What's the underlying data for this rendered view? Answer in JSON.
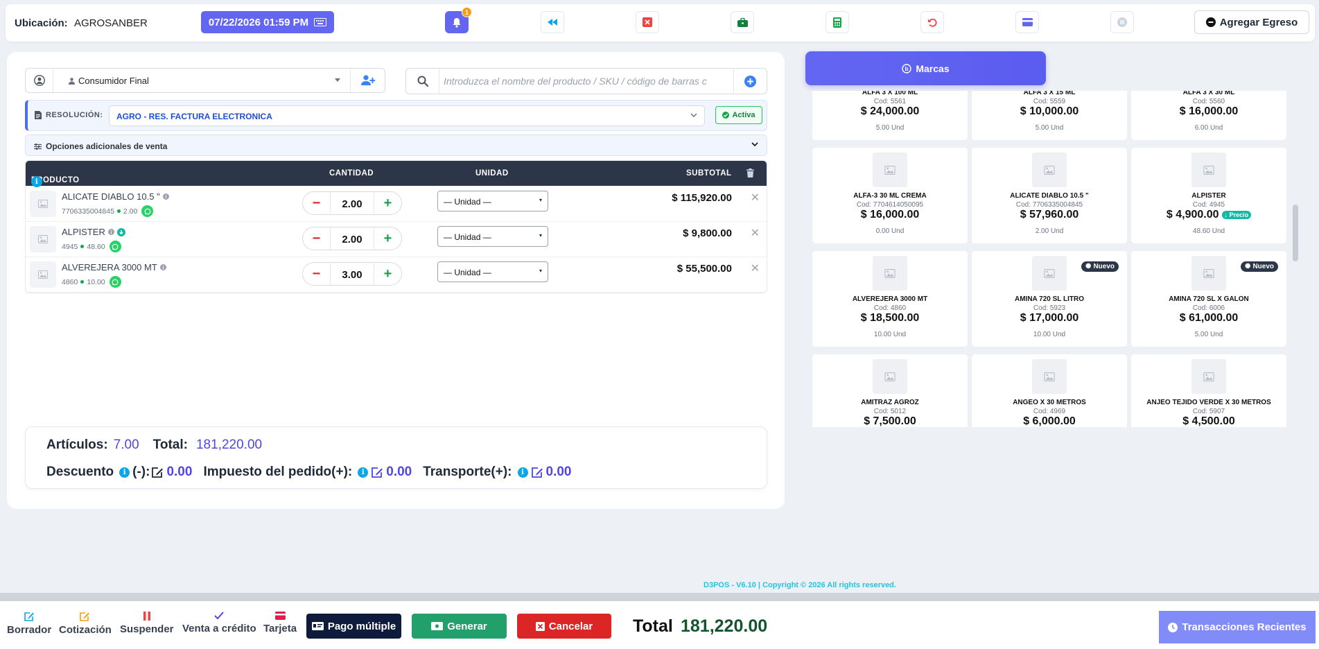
{
  "topbar": {
    "location_label": "Ubicación:",
    "location_value": "AGROSANBER",
    "datetime": "07/22/2026 01:59 PM",
    "notification_count": "1",
    "add_expense_label": "Agregar Egreso"
  },
  "customer": {
    "selected": "Consumidor Final"
  },
  "search": {
    "placeholder": "Introduzca el nombre del producto / SKU / código de barras c"
  },
  "resolution": {
    "label": "RESOLUCIÓN:",
    "selected": "AGRO - RES. FACTURA ELECTRONICA",
    "status": "Activa"
  },
  "options": {
    "label": "Opciones adicionales de venta"
  },
  "table": {
    "headers": {
      "product": "PRODUCTO",
      "quantity": "CANTIDAD",
      "unit": "UNIDAD",
      "subtotal": "SUBTOTAL"
    },
    "rows": [
      {
        "name": "ALICATE DIABLO 10.5 \"",
        "code": "7706335004845",
        "stock": "2.00",
        "qty": "2.00",
        "unit": "— Unidad —",
        "subtotal": "$ 115,920.00"
      },
      {
        "name": "ALPISTER",
        "code": "4945",
        "stock": "48.60",
        "qty": "2.00",
        "unit": "— Unidad —",
        "subtotal": "$ 9,800.00"
      },
      {
        "name": "ALVEREJERA 3000 MT",
        "code": "4860",
        "stock": "10.00",
        "qty": "3.00",
        "unit": "— Unidad —",
        "subtotal": "$ 55,500.00"
      }
    ]
  },
  "summary": {
    "articles_label": "Artículos:",
    "articles_value": "7.00",
    "total_label": "Total:",
    "total_value": "181,220.00",
    "discount_label": "Descuento",
    "discount_suffix": "(-):",
    "discount_value": "0.00",
    "tax_label": "Impuesto del pedido(+):",
    "tax_value": "0.00",
    "transport_label": "Transporte(+):",
    "transport_value": "0.00"
  },
  "brands_button": "Marcas",
  "products": [
    {
      "name": "ALFA 3 X 100 ML",
      "code": "Cod: 5561",
      "price": "$ 24,000.00",
      "stock": "5.00 Und"
    },
    {
      "name": "ALFA 3 X 15 ML",
      "code": "Cod: 5559",
      "price": "$ 10,000.00",
      "stock": "5.00 Und"
    },
    {
      "name": "ALFA 3 X 30 ML",
      "code": "Cod: 5560",
      "price": "$ 16,000.00",
      "stock": "6.00 Und"
    },
    {
      "name": "ALFA-3 30 ML CREMA",
      "code": "Cod: 7704614050095",
      "price": "$ 16,000.00",
      "stock": "0.00 Und"
    },
    {
      "name": "ALICATE DIABLO 10.5 \"",
      "code": "Cod: 7706335004845",
      "price": "$ 57,960.00",
      "stock": "2.00 Und"
    },
    {
      "name": "ALPISTER",
      "code": "Cod: 4945",
      "price": "$ 4,900.00",
      "stock": "48.60 Und",
      "badge": "Precio"
    },
    {
      "name": "ALVEREJERA 3000 MT",
      "code": "Cod: 4860",
      "price": "$ 18,500.00",
      "stock": "10.00 Und"
    },
    {
      "name": "AMINA 720 SL LITRO",
      "code": "Cod: 5923",
      "price": "$ 17,000.00",
      "stock": "10.00 Und",
      "tag": "Nuevo"
    },
    {
      "name": "AMINA 720 SL X GALON",
      "code": "Cod: 6006",
      "price": "$ 61,000.00",
      "stock": "5.00 Und",
      "tag": "Nuevo"
    },
    {
      "name": "AMITRAZ AGROZ",
      "code": "Cod: 5012",
      "price": "$ 7,500.00",
      "stock": ""
    },
    {
      "name": "ANGEO X 30 METROS",
      "code": "Cod: 4969",
      "price": "$ 6,000.00",
      "stock": ""
    },
    {
      "name": "ANJEO TEJIDO VERDE X 30 METROS",
      "code": "Cod: 5907",
      "price": "$ 4,500.00",
      "stock": ""
    }
  ],
  "footer": {
    "copyright": "D3POS - V6.10 | Copyright © 2026 All rights reserved."
  },
  "bottombar": {
    "draft": "Borrador",
    "quote": "Cotización",
    "suspend": "Suspender",
    "credit": "Venta a crédito",
    "card": "Tarjeta",
    "multi_pay": "Pago múltiple",
    "generate": "Generar",
    "cancel": "Cancelar",
    "total_label": "Total",
    "total_value": "181,220.00",
    "recent": "Transacciones Recientes"
  },
  "colors": {
    "accent": "#6366f1",
    "dark": "#2d3648",
    "success": "#22a06b",
    "danger": "#dc2626"
  }
}
